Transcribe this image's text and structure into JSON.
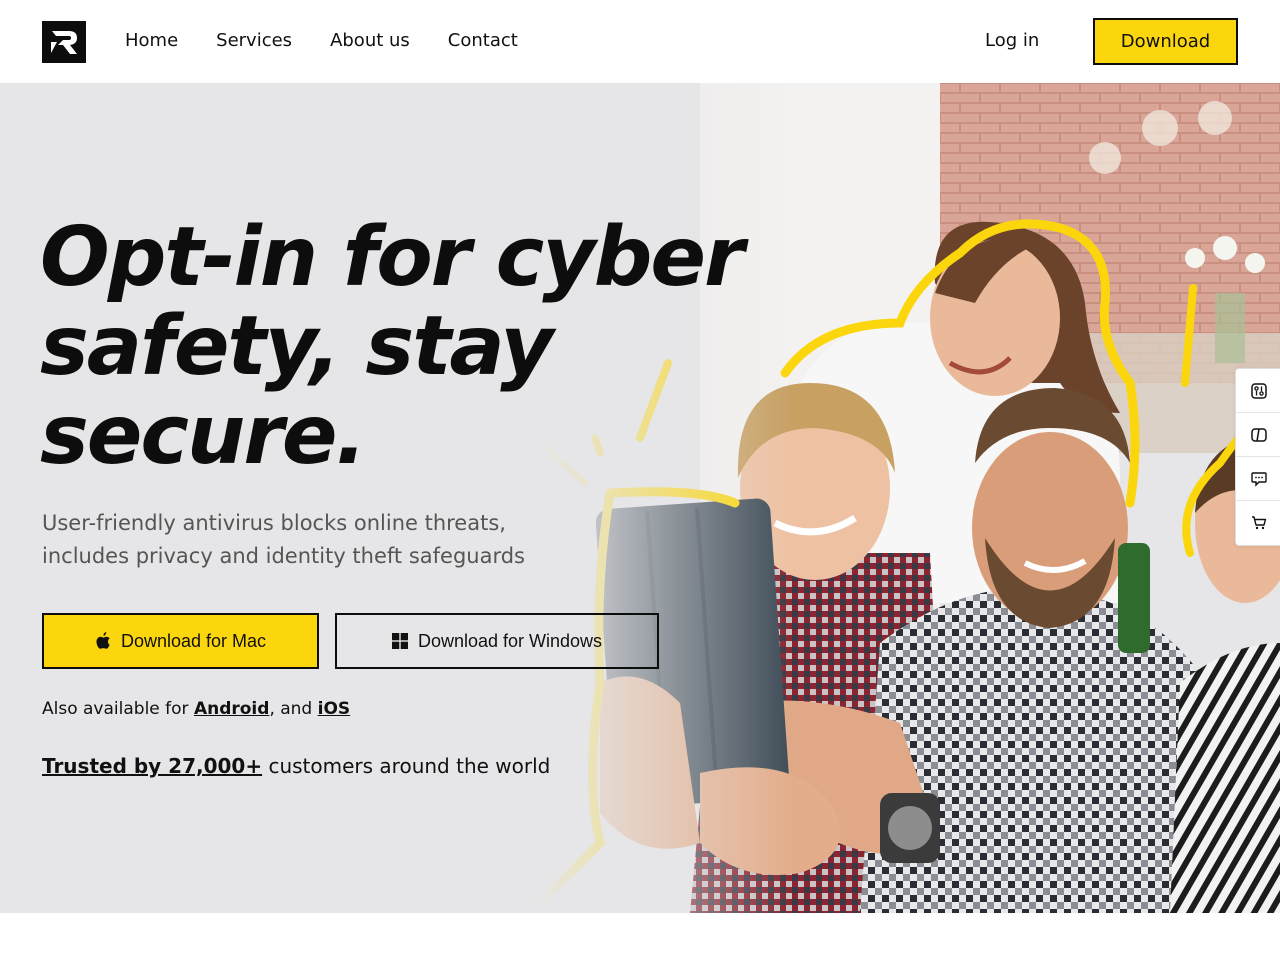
{
  "header": {
    "logo_icon": "brand-logo-icon",
    "nav": [
      {
        "label": "Home"
      },
      {
        "label": "Services"
      },
      {
        "label": "About us"
      },
      {
        "label": "Contact"
      }
    ],
    "login_label": "Log in",
    "download_label": "Download"
  },
  "hero": {
    "headline_lines": [
      "Opt-in for cyber",
      "safety, stay",
      "secure."
    ],
    "subtitle_lines": [
      "User-friendly antivirus blocks online threats,",
      "includes privacy and identity theft safeguards"
    ],
    "mac_button": {
      "label": "Download for Mac",
      "icon": "apple-icon"
    },
    "windows_button": {
      "label": "Download for Windows",
      "icon": "windows-icon"
    },
    "also_prefix": "Also available for ",
    "also_android": "Android",
    "also_separator": ", and ",
    "also_ios": "iOS",
    "trusted_link": "Trusted by 27,000+",
    "trusted_suffix": " customers around the world"
  },
  "side_tools": [
    {
      "icon": "settings-sliders-icon"
    },
    {
      "icon": "book-icon"
    },
    {
      "icon": "chat-icon"
    },
    {
      "icon": "cart-icon"
    }
  ],
  "colors": {
    "accent": "#fcd60c",
    "text": "#111111",
    "muted": "#555555",
    "hero_bg": "#e6e6e8"
  }
}
